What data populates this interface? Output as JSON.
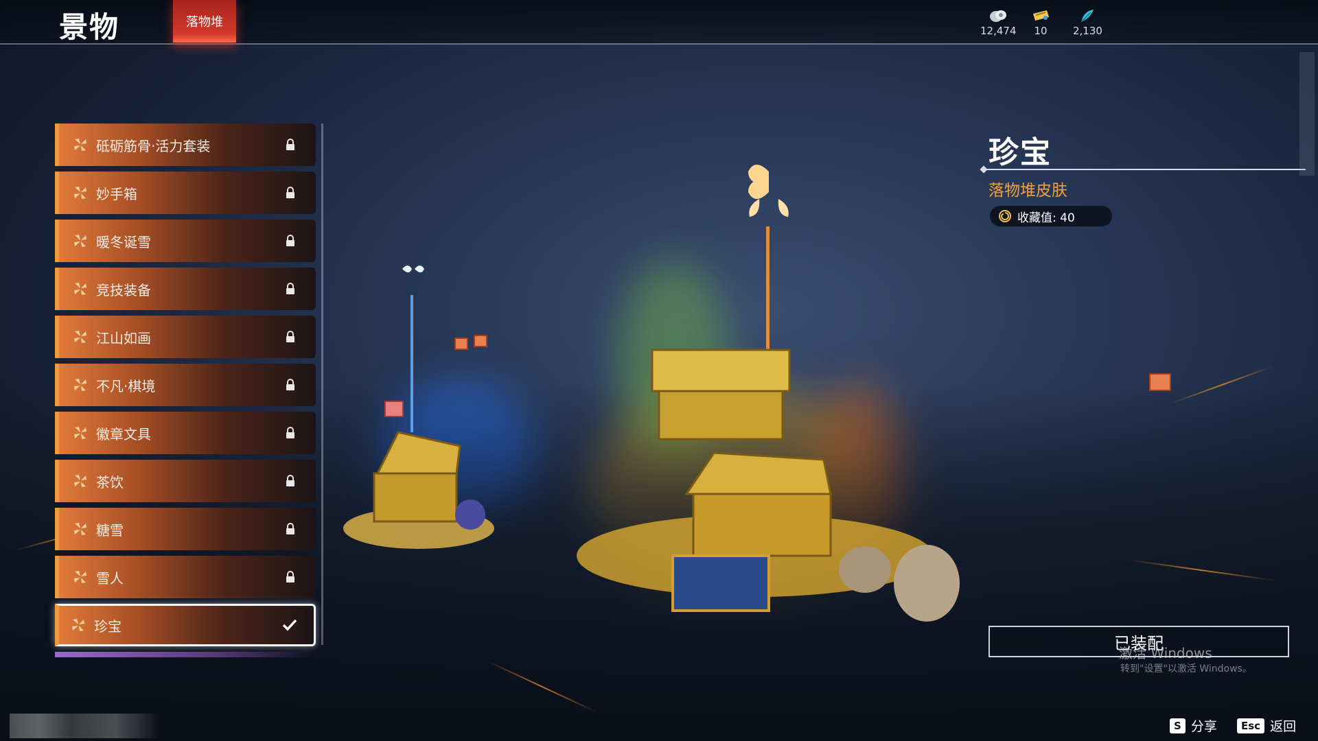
{
  "header": {
    "title": "景物",
    "active_tab": "落物堆"
  },
  "currencies": [
    {
      "icon": "silver-coin-icon",
      "value": "12,474"
    },
    {
      "icon": "gold-ticket-icon",
      "value": "10"
    },
    {
      "icon": "feather-icon",
      "value": "2,130"
    }
  ],
  "list": {
    "items": [
      {
        "label": "砥砺筋骨·活力套装",
        "status": "locked"
      },
      {
        "label": "妙手箱",
        "status": "locked"
      },
      {
        "label": "暖冬诞雪",
        "status": "locked"
      },
      {
        "label": "竞技装备",
        "status": "locked"
      },
      {
        "label": "江山如画",
        "status": "locked"
      },
      {
        "label": "不凡·棋境",
        "status": "locked"
      },
      {
        "label": "徽章文具",
        "status": "locked"
      },
      {
        "label": "茶饮",
        "status": "locked"
      },
      {
        "label": "糖雪",
        "status": "locked"
      },
      {
        "label": "雪人",
        "status": "locked"
      },
      {
        "label": "珍宝",
        "status": "equipped"
      }
    ]
  },
  "detail": {
    "name": "珍宝",
    "category": "落物堆皮肤",
    "collection_label": "收藏值: 40",
    "equip_label": "已装配"
  },
  "watermark": {
    "line1": "激活 Windows",
    "line2": "转到\"设置\"以激活 Windows。"
  },
  "hints": [
    {
      "key": "S",
      "label": "分享"
    },
    {
      "key": "Esc",
      "label": "返回"
    }
  ],
  "colors": {
    "tab_red": "#d33a2a",
    "item_orange": "#e07a3a",
    "accent_gold": "#f0a040"
  }
}
